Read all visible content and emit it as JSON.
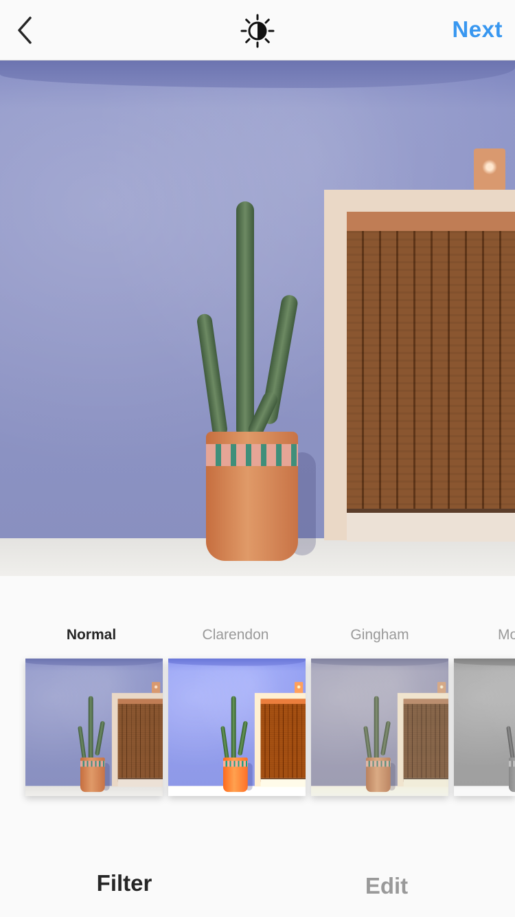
{
  "header": {
    "back_icon": "chevron-left-icon",
    "lux_icon": "lux-sun-icon",
    "next_label": "Next",
    "accent_color": "#3897f0"
  },
  "filters": [
    {
      "label": "Normal",
      "selected": true
    },
    {
      "label": "Clarendon",
      "selected": false
    },
    {
      "label": "Gingham",
      "selected": false
    },
    {
      "label": "Mo",
      "selected": false
    }
  ],
  "tabs": {
    "filter_label": "Filter",
    "edit_label": "Edit"
  }
}
